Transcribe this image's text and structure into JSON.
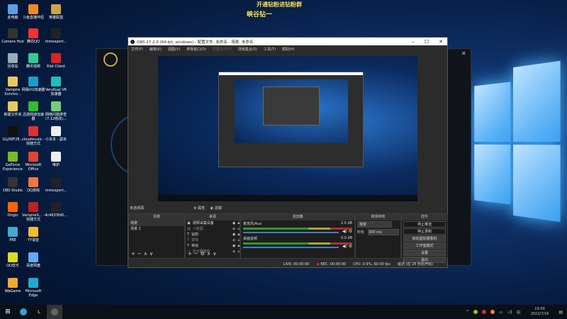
{
  "overlay": {
    "line1": "开通钻粉进钻粉群",
    "line2": "峡谷钻一"
  },
  "desktop_icons": [
    {
      "label": "此电脑",
      "color": "#5aa0e6"
    },
    {
      "label": "斗鱼直播伴侣",
      "color": "#f08a24"
    },
    {
      "label": "英雄联盟",
      "color": "#c9a44a"
    },
    {
      "label": "Camera Hub",
      "color": "#333"
    },
    {
      "label": "腾讯QQ",
      "color": "#e33"
    },
    {
      "label": "mmexport...",
      "color": "#222"
    },
    {
      "label": "回收站",
      "color": "#9ab"
    },
    {
      "label": "腾讯视频",
      "color": "#3c9"
    },
    {
      "label": "Riot Client",
      "color": "#d22"
    },
    {
      "label": "Vampire Survivo...",
      "color": "#e8c860"
    },
    {
      "label": "网易UU加速器",
      "color": "#29c"
    },
    {
      "label": "VeryKuai VK加速器",
      "color": "#2bb"
    },
    {
      "label": "新建文件夹",
      "color": "#e8c860"
    },
    {
      "label": "迅游网游加速器",
      "color": "#3b3"
    },
    {
      "label": "网络问题排查(7.12修改)...",
      "color": "#7c7"
    },
    {
      "label": "GLJX8F28...",
      "color": "#111"
    },
    {
      "label": "cloudmusic - 快捷方式",
      "color": "#d33"
    },
    {
      "label": "小本本 - 副本",
      "color": "#eee"
    },
    {
      "label": "GeForce Experience",
      "color": "#7b2"
    },
    {
      "label": "Microsoft Office",
      "color": "#d43"
    },
    {
      "label": "维护",
      "color": "#eee"
    },
    {
      "label": "OBS Studio",
      "color": "#333"
    },
    {
      "label": "QQ游戏",
      "color": "#e74"
    },
    {
      "label": "mmexport...",
      "color": "#222"
    },
    {
      "label": "Origin",
      "color": "#f60"
    },
    {
      "label": "VampireS... - 快捷方式",
      "color": "#b22"
    },
    {
      "label": "4c4633fd0...",
      "color": "#222"
    },
    {
      "label": "PBE",
      "color": "#4ac"
    },
    {
      "label": "YY语音",
      "color": "#eb3"
    },
    {
      "label": "",
      "color": "transparent"
    },
    {
      "label": "QQ音乐",
      "color": "#dd2"
    },
    {
      "label": "百度网盘",
      "color": "#6ae"
    },
    {
      "label": "",
      "color": "transparent"
    },
    {
      "label": "WeGame",
      "color": "#ea3"
    },
    {
      "label": "Microsoft Edge",
      "color": "#2ac"
    },
    {
      "label": "",
      "color": "transparent"
    }
  ],
  "obs": {
    "title": "OBS 27.2.0 (64-bit, windows) - 配置文件: 未命名 - 场景: 未命名",
    "menu": [
      "文件(F)",
      "编辑(E)",
      "视图(V)",
      "停靠窗口(D)",
      "配置文件(P)",
      "场景集合(S)",
      "工具(T)",
      "帮助(H)"
    ],
    "no_source": "未选择源",
    "properties": "属性",
    "filters": "滤镜",
    "docks": {
      "scenes": "场景",
      "sources": "来源",
      "mixer": "混音器",
      "transitions": "转场特效",
      "controls": "控件"
    },
    "scenes": [
      "场景",
      "场景 2"
    ],
    "sources": [
      "视频采集设备",
      "小窗图",
      "钻粉",
      "装饰",
      "峡谷",
      "显示器捕获"
    ],
    "mixer": [
      {
        "name": "麦克风/Aux",
        "db": "2.0 dB"
      },
      {
        "name": "桌面音频",
        "db": "0.0 dB"
      }
    ],
    "transition": {
      "type": "渐变",
      "duration_label": "时长",
      "duration": "300 ms"
    },
    "controls": [
      "停止推流",
      "停止录制",
      "启动虚拟摄像机",
      "工作室模式",
      "设置",
      "退出"
    ],
    "status": {
      "live": "LIVE: 00:00:00",
      "rec": "REC: 00:00:00",
      "cpu": "CPU: 0.9%, 60.00 fps",
      "delay": "延迟 (在 25 秒后开始)"
    }
  },
  "tray": {
    "time": "19:59",
    "date": "2022/7/16"
  }
}
